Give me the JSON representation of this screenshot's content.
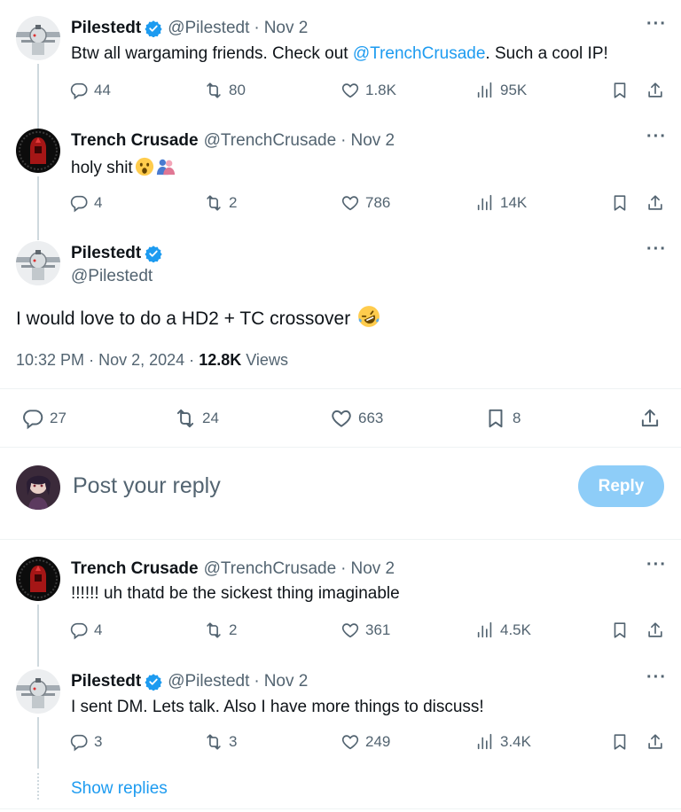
{
  "tweets": [
    {
      "name": "Pilestedt",
      "handle": "@Pilestedt",
      "dot": "·",
      "date": "Nov 2",
      "text_before": "Btw all wargaming friends. Check out ",
      "mention": "@TrenchCrusade",
      "text_after": ". Such a cool IP!",
      "replies": "44",
      "reposts": "80",
      "likes": "1.8K",
      "views": "95K"
    },
    {
      "name": "Trench Crusade",
      "handle": "@TrenchCrusade",
      "dot": "·",
      "date": "Nov 2",
      "text": "holy shit",
      "emojis": [
        "astonished-face-emoji",
        "people-hugging-emoji"
      ],
      "replies": "4",
      "reposts": "2",
      "likes": "786",
      "views": "14K"
    }
  ],
  "main_tweet": {
    "name": "Pilestedt",
    "handle": "@Pilestedt",
    "text": "I would love to do a HD2 + TC crossover",
    "emoji": "rolling-on-floor-laughing-emoji",
    "time": "10:32 PM",
    "dot1": "·",
    "date": "Nov 2, 2024",
    "dot2": "·",
    "views_count": "12.8K",
    "views_label": "Views",
    "replies": "27",
    "reposts": "24",
    "likes": "663",
    "bookmarks": "8"
  },
  "reply_box": {
    "placeholder": "Post your reply",
    "button": "Reply"
  },
  "replies_thread": [
    {
      "name": "Trench Crusade",
      "handle": "@TrenchCrusade",
      "dot": "·",
      "date": "Nov 2",
      "text": "!!!!!! uh thatd be the sickest thing imaginable",
      "replies": "4",
      "reposts": "2",
      "likes": "361",
      "views": "4.5K"
    },
    {
      "name": "Pilestedt",
      "handle": "@Pilestedt",
      "dot": "·",
      "date": "Nov 2",
      "text": "I sent DM. Lets talk. Also I have more things to discuss!",
      "replies": "3",
      "reposts": "3",
      "likes": "249",
      "views": "3.4K"
    }
  ],
  "show_replies": "Show replies",
  "colors": {
    "accent": "#1d9bf0",
    "muted": "#536471",
    "reply_button": "#8ecdf8"
  }
}
